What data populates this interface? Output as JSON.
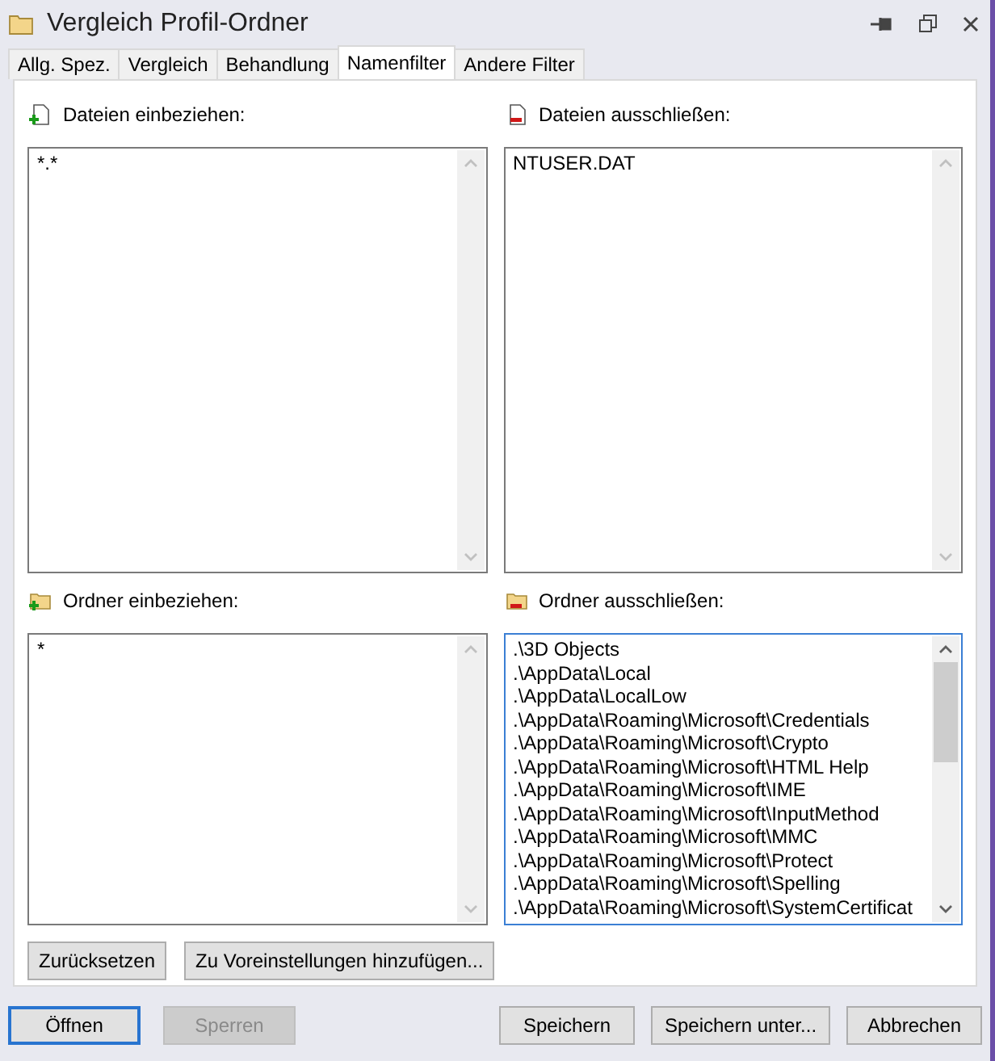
{
  "window": {
    "title": "Vergleich Profil-Ordner"
  },
  "tabs": [
    {
      "label": "Allg. Spez.",
      "selected": false
    },
    {
      "label": "Vergleich",
      "selected": false
    },
    {
      "label": "Behandlung",
      "selected": false
    },
    {
      "label": "Namenfilter",
      "selected": true
    },
    {
      "label": "Andere Filter",
      "selected": false
    }
  ],
  "filters": [
    {
      "kind": "include-file",
      "label": "Dateien einbeziehen:",
      "focused": false,
      "items": [
        "*.*"
      ]
    },
    {
      "kind": "exclude-file",
      "label": "Dateien ausschließen:",
      "focused": false,
      "items": [
        "NTUSER.DAT"
      ]
    },
    {
      "kind": "include-folder",
      "label": "Ordner einbeziehen:",
      "focused": false,
      "items": [
        "*"
      ]
    },
    {
      "kind": "exclude-folder",
      "label": "Ordner ausschließen:",
      "focused": true,
      "items": [
        ".\\3D Objects",
        ".\\AppData\\Local",
        ".\\AppData\\LocalLow",
        ".\\AppData\\Roaming\\Microsoft\\Credentials",
        ".\\AppData\\Roaming\\Microsoft\\Crypto",
        ".\\AppData\\Roaming\\Microsoft\\HTML Help",
        ".\\AppData\\Roaming\\Microsoft\\IME",
        ".\\AppData\\Roaming\\Microsoft\\InputMethod",
        ".\\AppData\\Roaming\\Microsoft\\MMC",
        ".\\AppData\\Roaming\\Microsoft\\Protect",
        ".\\AppData\\Roaming\\Microsoft\\Spelling",
        ".\\AppData\\Roaming\\Microsoft\\SystemCertificat"
      ]
    }
  ],
  "panel_buttons": [
    "Zurücksetzen",
    "Zu Voreinstellungen hinzufügen..."
  ],
  "footer_buttons": [
    {
      "label": "Öffnen",
      "disabled": false,
      "focused": true
    },
    {
      "label": "Sperren",
      "disabled": true,
      "focused": false
    },
    {
      "label": "Speichern",
      "disabled": false,
      "focused": false
    },
    {
      "label": "Speichern unter...",
      "disabled": false,
      "focused": false
    },
    {
      "label": "Abbrechen",
      "disabled": false,
      "focused": false
    }
  ]
}
